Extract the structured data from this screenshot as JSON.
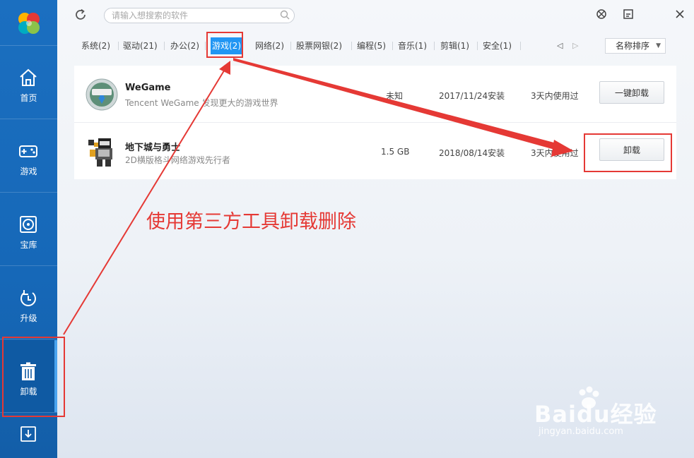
{
  "sidebar": {
    "items": [
      {
        "label": "首页",
        "icon": "home-icon"
      },
      {
        "label": "游戏",
        "icon": "gamepad-icon"
      },
      {
        "label": "宝库",
        "icon": "disc-icon"
      },
      {
        "label": "升级",
        "icon": "upgrade-icon"
      },
      {
        "label": "卸载",
        "icon": "trash-icon"
      }
    ]
  },
  "search": {
    "placeholder": "请输入想搜索的软件"
  },
  "categories": [
    {
      "label": "系统(2)"
    },
    {
      "label": "驱动(21)"
    },
    {
      "label": "办公(2)"
    },
    {
      "label": "游戏(2)",
      "active": true
    },
    {
      "label": "网络(2)"
    },
    {
      "label": "股票网银(2)"
    },
    {
      "label": "编程(5)"
    },
    {
      "label": "音乐(1)"
    },
    {
      "label": "剪辑(1)"
    },
    {
      "label": "安全(1)"
    }
  ],
  "sort": {
    "label": "名称排序"
  },
  "apps": [
    {
      "name": "WeGame",
      "desc": "Tencent WeGame 发现更大的游戏世界",
      "size": "未知",
      "installed": "2017/11/24安装",
      "used": "3天内使用过",
      "button": "一键卸载"
    },
    {
      "name": "地下城与勇士",
      "desc": "2D横版格斗网络游戏先行者",
      "size": "1.5 GB",
      "installed": "2018/08/14安装",
      "used": "3天内使用过",
      "button": "卸载"
    }
  ],
  "annotation": {
    "text": "使用第三方工具卸载删除"
  },
  "watermark": {
    "brand": "Baidu经验",
    "url": "jingyan.baidu.com"
  },
  "colors": {
    "sidebar": "#1668b8",
    "accent": "#2196f3",
    "annotation_red": "#e53935"
  }
}
